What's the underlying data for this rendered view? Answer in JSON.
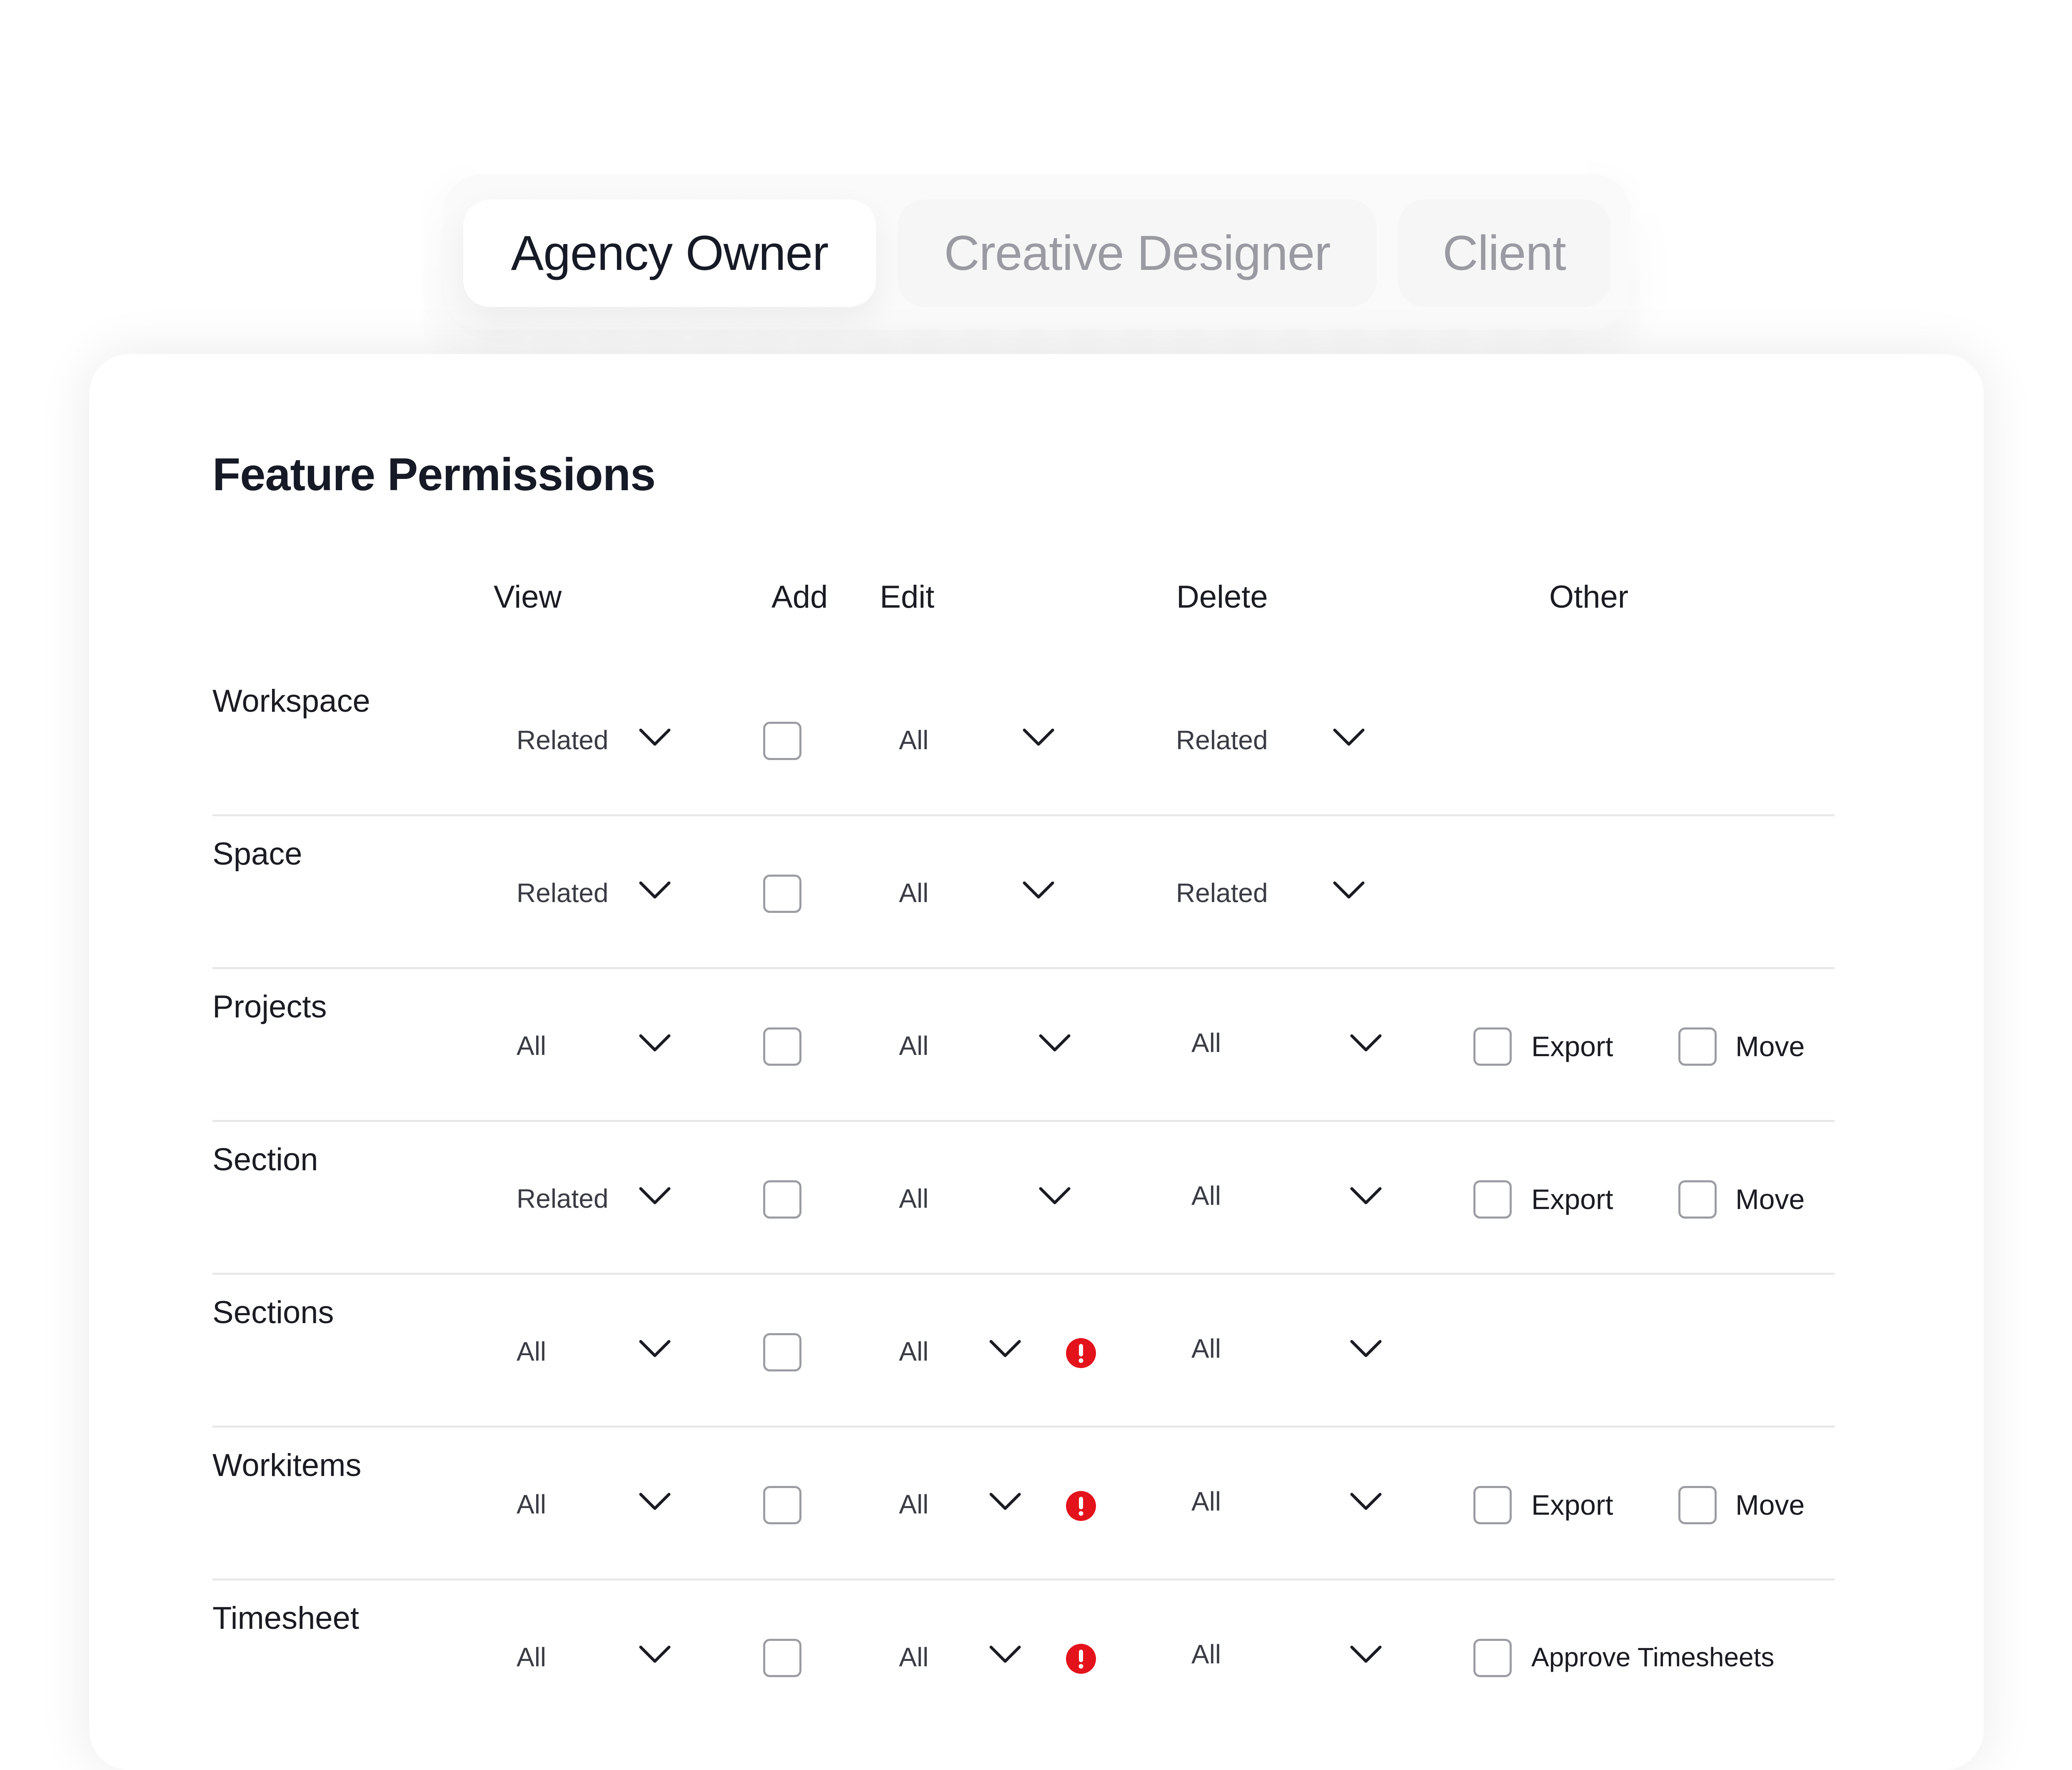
{
  "role_tabs": [
    {
      "label": "Agency Owner",
      "selected": true
    },
    {
      "label": "Creative Designer",
      "selected": false
    },
    {
      "label": "Client",
      "selected": false
    }
  ],
  "section_title": "Feature Permissions",
  "columns": {
    "view": "View",
    "add": "Add",
    "edit": "Edit",
    "delete": "Delete",
    "other": "Other"
  },
  "rows": [
    {
      "name": "Workspace",
      "view": "Related",
      "add_checked": false,
      "edit": "All",
      "edit_warning": false,
      "delete": "Related",
      "other": []
    },
    {
      "name": "Space",
      "view": "Related",
      "add_checked": false,
      "edit": "All",
      "edit_warning": false,
      "delete": "Related",
      "other": []
    },
    {
      "name": "Projects",
      "view": "All",
      "add_checked": false,
      "edit": "All",
      "edit_warning": false,
      "delete": "All",
      "other": [
        "Export",
        "Move"
      ]
    },
    {
      "name": "Section",
      "view": "Related",
      "add_checked": false,
      "edit": "All",
      "edit_warning": false,
      "delete": "All",
      "other": [
        "Export",
        "Move"
      ]
    },
    {
      "name": "Sections",
      "view": "All",
      "add_checked": false,
      "edit": "All",
      "edit_warning": true,
      "delete": "All",
      "other": []
    },
    {
      "name": "Workitems",
      "view": "All",
      "add_checked": false,
      "edit": "All",
      "edit_warning": true,
      "delete": "All",
      "other": [
        "Export",
        "Move"
      ]
    },
    {
      "name": "Timesheet",
      "view": "All",
      "add_checked": false,
      "edit": "All",
      "edit_warning": true,
      "delete": "All",
      "other": [
        "Approve Timesheets"
      ]
    }
  ],
  "icons": {
    "dropdown": "chevron-down-icon",
    "warning": "alert-circle-icon",
    "checkbox": "checkbox-unchecked"
  },
  "colors": {
    "accent_warning": "#e3121b",
    "tab_active_text": "#161a26",
    "tab_inactive_text": "#9a9ba2",
    "row_divider": "#e8e8ea"
  }
}
